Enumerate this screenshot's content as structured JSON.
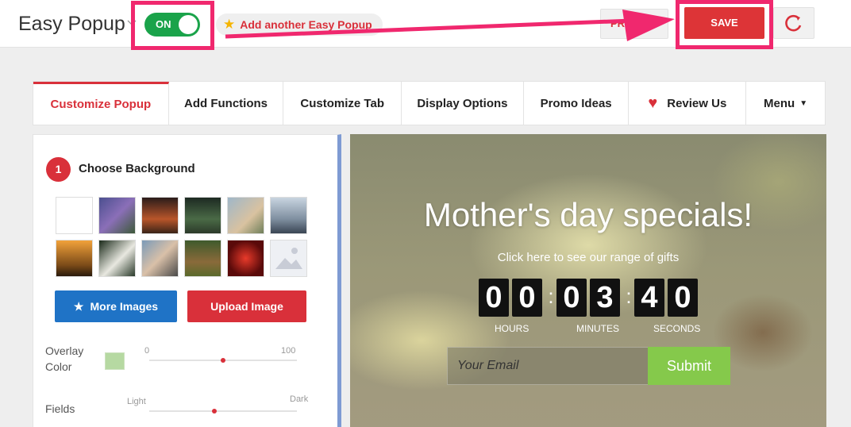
{
  "topbar": {
    "app_title": "Easy Popup",
    "toggle_label": "ON",
    "add_popup_label": "Add another Easy Popup",
    "preview_label": "PREVIEW",
    "save_label": "SAVE",
    "toggle_on": true
  },
  "tabs": [
    {
      "label": "Customize Popup",
      "active": true
    },
    {
      "label": "Add Functions"
    },
    {
      "label": "Customize Tab"
    },
    {
      "label": "Display Options"
    },
    {
      "label": "Promo Ideas"
    },
    {
      "label": "Review Us",
      "icon": "heart-icon"
    },
    {
      "label": "Menu",
      "icon": "caret-down-icon"
    }
  ],
  "background_panel": {
    "step_number": "1",
    "step_title": "Choose Background",
    "more_images_label": "More Images",
    "upload_image_label": "Upload Image",
    "overlay_label_line1": "Overlay",
    "overlay_label_line2": "Color",
    "overlay_color": "#b6d9a2",
    "overlay_min": "0",
    "overlay_max": "100",
    "overlay_value": 0.5,
    "fields_label": "Fields",
    "fields_min": "Light",
    "fields_max": "Dark",
    "fields_value": 0.44
  },
  "popup_preview": {
    "title": "Mother's day specials!",
    "subtitle": "Click here to see our range of gifts",
    "hours": [
      "0",
      "0"
    ],
    "minutes": [
      "0",
      "3"
    ],
    "seconds": [
      "4",
      "0"
    ],
    "hours_label": "HOURS",
    "minutes_label": "MINUTES",
    "seconds_label": "SECONDS",
    "email_placeholder": "Your Email",
    "submit_label": "Submit"
  },
  "colors": {
    "accent_red": "#d9303a",
    "highlight_pink": "#f0286e",
    "toggle_green": "#1aa34a",
    "button_blue": "#1f73c6",
    "submit_green": "#85c94b"
  }
}
